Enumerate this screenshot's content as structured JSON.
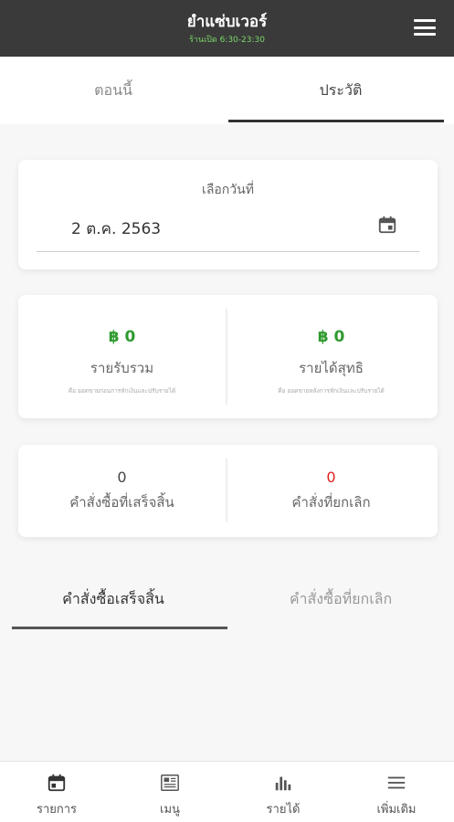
{
  "header": {
    "title": "ยำแซ่บเวอร์",
    "hours": "ร้านเปิด 6:30-23:30",
    "menu_icon": "hamburger-icon"
  },
  "tabs": [
    {
      "label": "ตอนนี้",
      "active": false
    },
    {
      "label": "ประวัติ",
      "active": true
    }
  ],
  "date_picker": {
    "label": "เลือกวันที่",
    "value": "2 ต.ค. 2563",
    "icon": "calendar-icon"
  },
  "revenue": {
    "total": {
      "amount": "฿ 0",
      "title": "รายรับรวม",
      "note": "คือ ยอดขายก่อนการหักเงินและปรับรายได้"
    },
    "net": {
      "amount": "฿ 0",
      "title": "รายได้สุทธิ",
      "note": "คือ ยอดขายหลังการหักเงินและปรับรายได้"
    }
  },
  "orders": {
    "completed": {
      "count": "0",
      "title": "คำสั่งซื้อที่เสร็จสิ้น"
    },
    "cancelled": {
      "count": "0",
      "title": "คำสั่งที่ยกเลิก"
    }
  },
  "order_tabs": [
    {
      "label": "คำสั่งซื้อเสร็จสิ้น",
      "active": true
    },
    {
      "label": "คำสั่งซื้อที่ยกเลิก",
      "active": false
    }
  ],
  "bottom_nav": [
    {
      "label": "รายการ",
      "icon": "calendar-icon"
    },
    {
      "label": "เมนู",
      "icon": "newspaper-icon"
    },
    {
      "label": "รายได้",
      "icon": "bar-chart-icon"
    },
    {
      "label": "เพิ่มเติม",
      "icon": "hamburger-icon"
    }
  ],
  "colors": {
    "header_bg": "#3a3a3a",
    "hours": "#7cd86a",
    "amount": "#2e9a2e",
    "cancelled": "#e02020"
  }
}
